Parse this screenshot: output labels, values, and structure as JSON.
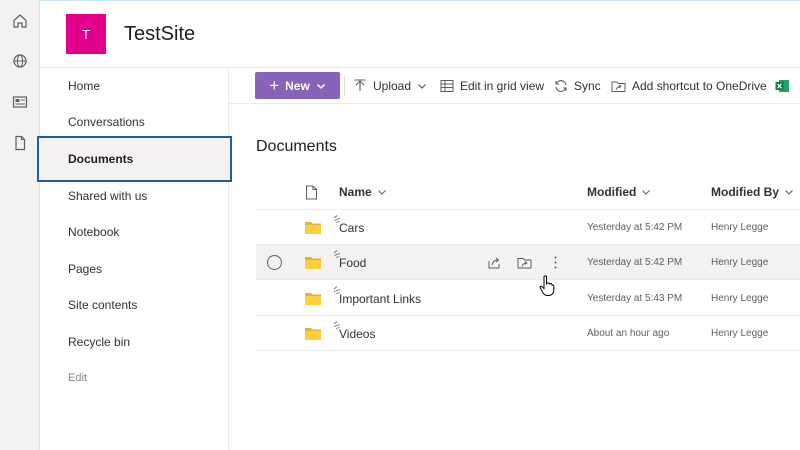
{
  "site": {
    "logo_letter": "T",
    "title": "TestSite",
    "logo_color": "#e3008c"
  },
  "rail": {
    "icons": [
      "home-icon",
      "globe-icon",
      "news-icon",
      "file-icon"
    ]
  },
  "nav": {
    "items": [
      {
        "label": "Home"
      },
      {
        "label": "Conversations"
      },
      {
        "label": "Documents",
        "selected": true
      },
      {
        "label": "Shared with us"
      },
      {
        "label": "Notebook"
      },
      {
        "label": "Pages"
      },
      {
        "label": "Site contents"
      },
      {
        "label": "Recycle bin"
      },
      {
        "label": "Edit"
      }
    ]
  },
  "commandbar": {
    "new_label": "New",
    "upload_label": "Upload",
    "grid_label": "Edit in grid view",
    "sync_label": "Sync",
    "shortcut_label": "Add shortcut to OneDrive",
    "accent": "#8764b8"
  },
  "library": {
    "title": "Documents",
    "columns": {
      "name": "Name",
      "modified": "Modified",
      "modified_by": "Modified By"
    },
    "rows": [
      {
        "name": "Cars",
        "modified": "Yesterday at 5:42 PM",
        "modified_by": "Henry Legge"
      },
      {
        "name": "Food",
        "modified": "Yesterday at 5:42 PM",
        "modified_by": "Henry Legge"
      },
      {
        "name": "Important Links",
        "modified": "Yesterday at 5:43 PM",
        "modified_by": "Henry Legge"
      },
      {
        "name": "Videos",
        "modified": "About an hour ago",
        "modified_by": "Henry Legge"
      }
    ]
  }
}
